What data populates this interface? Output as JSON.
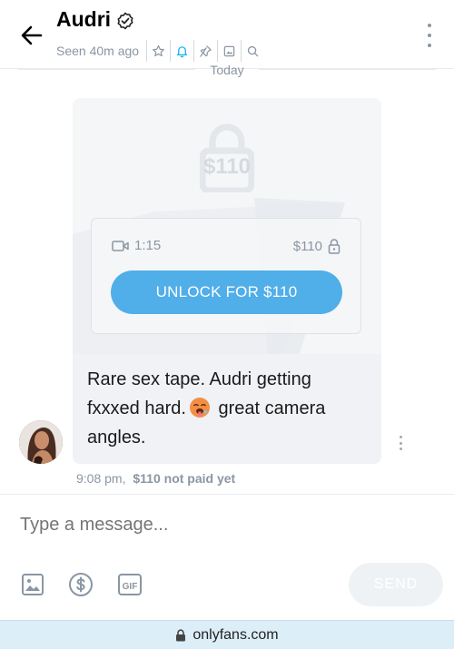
{
  "header": {
    "title": "Audri",
    "seen": "Seen 40m ago",
    "icons": [
      "back-arrow-icon",
      "verified-icon",
      "star-icon",
      "bell-icon",
      "pin-icon",
      "image-icon",
      "search-icon",
      "more-icon"
    ],
    "accent": "#00aff0"
  },
  "date_divider": "Today",
  "message": {
    "locked_price": "$110",
    "duration": "1:15",
    "price": "$110",
    "unlock_label": "UNLOCK FOR $110",
    "text_before_emoji": "Rare sex tape. Audri getting fxxxed hard.",
    "text_after_emoji": "great camera angles.",
    "time": "9:08 pm,",
    "price_state": "$110 not paid yet",
    "button_color": "#50aee9"
  },
  "composer": {
    "placeholder": "Type a message...",
    "send_label": "SEND"
  },
  "browser": {
    "url": "onlyfans.com"
  }
}
